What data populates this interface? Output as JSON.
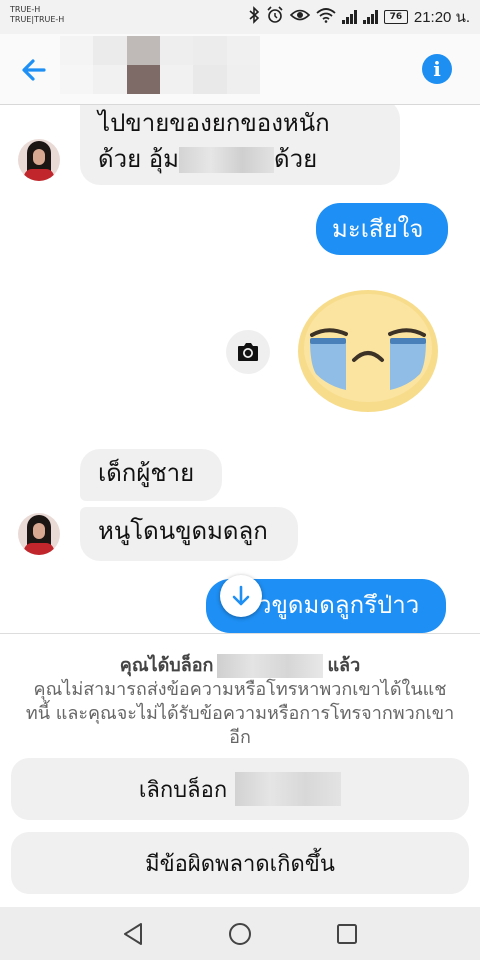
{
  "status_bar": {
    "carrier_line1": "TRUE-H",
    "carrier_line2": "TRUE|TRUE-H",
    "battery": "76",
    "time": "21:20 น."
  },
  "header": {
    "back_icon": "arrow-left-icon",
    "info_icon": "info-icon",
    "contact_name": ""
  },
  "messages": [
    {
      "sender": "contact",
      "line1": "ไปขายของยกของหนัก",
      "line2_prefix": "ด้วย อุ้ม",
      "line2_suffix": "ด้วย"
    },
    {
      "sender": "me",
      "text": "มะเสียใจ"
    },
    {
      "sender": "me",
      "type": "sticker",
      "icon": "crying-face-icon"
    },
    {
      "sender": "contact",
      "text": "เด็กผู้ชาย"
    },
    {
      "sender": "contact",
      "text": "หนูโดนขูดมดลูก"
    },
    {
      "sender": "me",
      "text": "วขูดมดลูกรึป่าว"
    }
  ],
  "blocked": {
    "title_prefix": "คุณได้บล็อก",
    "title_suffix": "แล้ว",
    "description": "คุณไม่สามารถส่งข้อความหรือโทรหาพวกเขาได้ในแชทนี้ และคุณจะไม่ได้รับข้อความหรือการโทรจากพวกเขาอีก",
    "unblock_label": "เลิกบล็อก",
    "error_label": "มีข้อผิดพลาดเกิดขึ้น"
  },
  "colors": {
    "accent": "#1e8ff4",
    "incoming_bubble": "#f1f0f0"
  }
}
